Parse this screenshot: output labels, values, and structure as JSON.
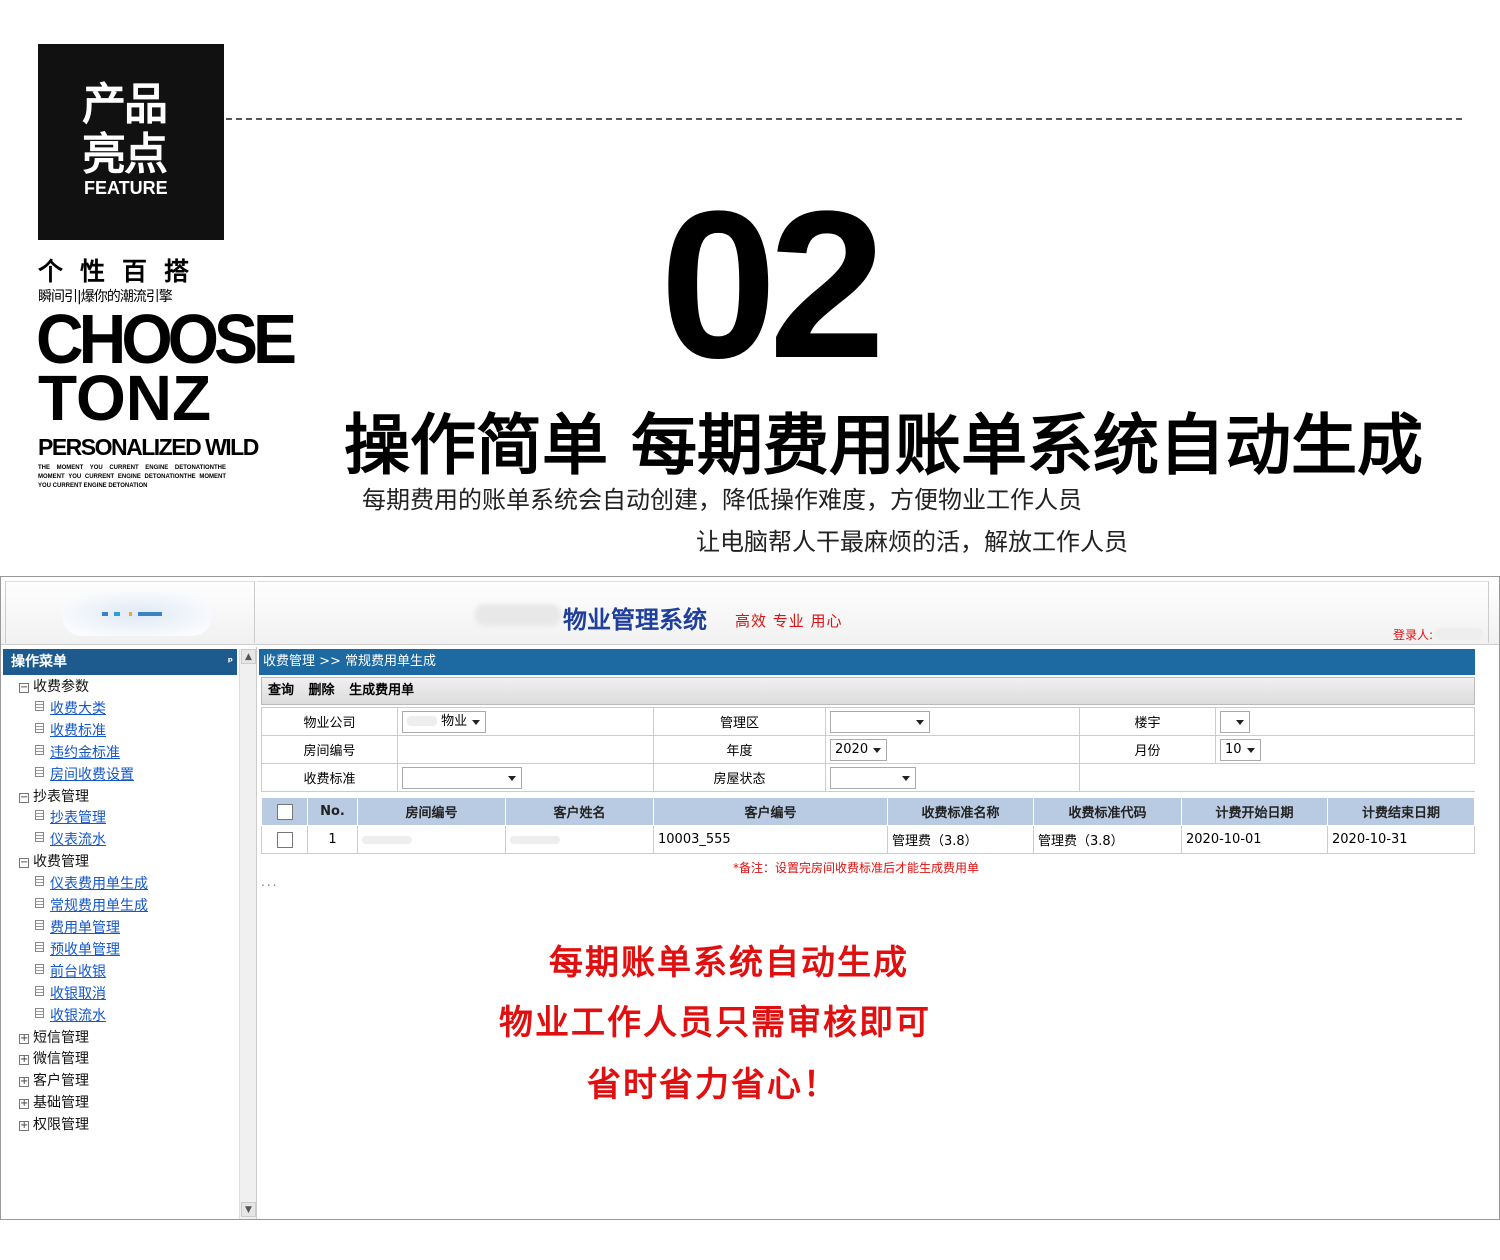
{
  "banner": {
    "brand_line1": "产品",
    "brand_line2": "亮点",
    "brand_feature": "FEATURE",
    "brand_sub1": "个性百搭",
    "brand_sub2": "瞬间引|爆你的潮流引擎",
    "brand_choose": "CHOOSE",
    "brand_tonz": "TONZ",
    "brand_pw": "PERSONALIZED WILD",
    "brand_small": "THE MOMENT YOU CURRENT ENGINE DETONATIONTHE MOMENT YOU CURRENT ENGINE DETONATIONTHE MOMENT YOU CURRENT ENGINE DETONATION",
    "number": "02",
    "headline": "操作简单  每期费用账单系统自动生成",
    "desc1": "每期费用的账单系统会自动创建，降低操作难度，方便物业工作人员",
    "desc2": "让电脑帮人干最麻烦的活，解放工作人员"
  },
  "header": {
    "system_title": "物业管理系统",
    "slogan": "高效 专业 用心",
    "login_label": "登录人:"
  },
  "sidebar": {
    "title": "操作菜单",
    "pin": "ᵖ",
    "groups": [
      {
        "label": "收费参数",
        "items": [
          "收费大类",
          "收费标准",
          "违约金标准",
          "房间收费设置"
        ]
      },
      {
        "label": "抄表管理",
        "items": [
          "抄表管理",
          "仪表流水"
        ]
      },
      {
        "label": "收费管理",
        "items": [
          "仪表费用单生成",
          "常规费用单生成",
          "费用单管理",
          "预收单管理",
          "前台收银",
          "收银取消",
          "收银流水"
        ]
      }
    ],
    "collapsed": [
      "短信管理",
      "微信管理",
      "客户管理",
      "基础管理",
      "权限管理"
    ]
  },
  "main": {
    "breadcrumb": "收费管理 >> 常规费用单生成",
    "toolbar": {
      "query": "查询",
      "delete": "删除",
      "generate": "生成费用单"
    },
    "filters": {
      "company_label": "物业公司",
      "company_value": "物业",
      "area_label": "管理区",
      "area_value": "",
      "building_label": "楼宇",
      "building_value": "",
      "room_label": "房间编号",
      "room_value": "",
      "year_label": "年度",
      "year_value": "2020",
      "month_label": "月份",
      "month_value": "10",
      "standard_label": "收费标准",
      "standard_value": "",
      "status_label": "房屋状态",
      "status_value": ""
    },
    "table": {
      "headers": [
        "No.",
        "房间编号",
        "客户姓名",
        "客户编号",
        "收费标准名称",
        "收费标准代码",
        "计费开始日期",
        "计费结束日期"
      ],
      "rows": [
        {
          "no": "1",
          "customer_no": "10003_555",
          "std_name": "管理费（3.8）",
          "std_code": "管理费（3.8）",
          "start": "2020-10-01",
          "end": "2020-10-31"
        }
      ]
    },
    "note": "*备注：设置完房间收费标准后才能生成费用单",
    "ellipsis": "...",
    "callouts": [
      "每期账单系统自动生成",
      "物业工作人员只需审核即可",
      "省时省力省心！"
    ]
  },
  "icons": {
    "expanded": "minus-box-icon",
    "collapsed": "plus-box-icon",
    "leaf": "document-icon"
  },
  "colors": {
    "menu_head": "#1d5b8f",
    "breadcrumb": "#1d6aa3",
    "table_header": "#b8cbe3",
    "accent_red": "#e01010",
    "title_blue": "#1f3f9c"
  }
}
